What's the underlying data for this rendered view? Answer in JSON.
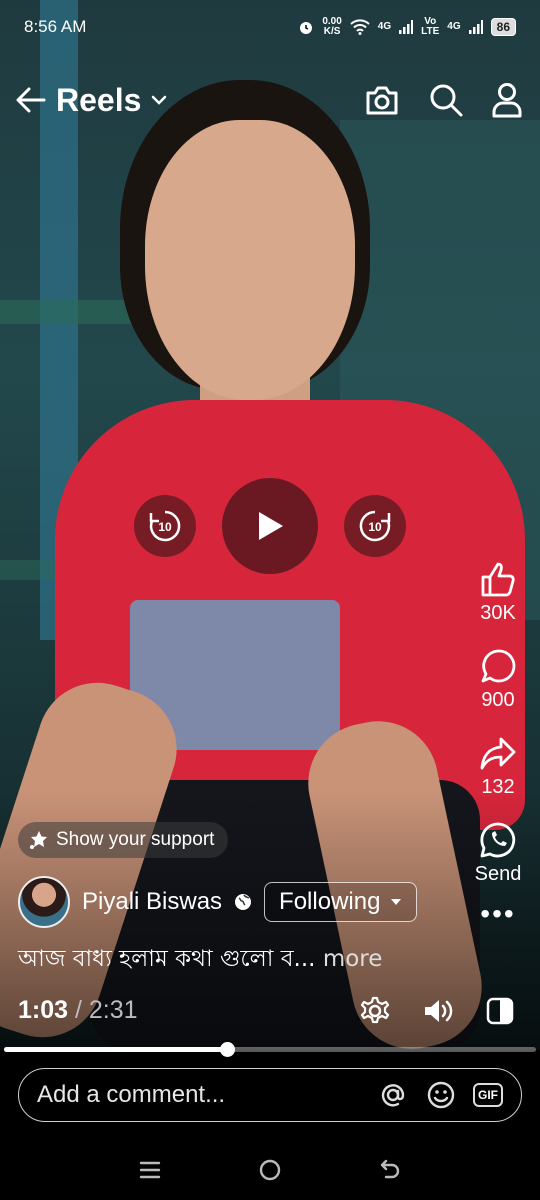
{
  "status_bar": {
    "time": "8:56 AM",
    "speed_value": "0.00",
    "speed_unit": "K/S",
    "network1": "4G",
    "network2_top": "Vo",
    "network2_bottom": "LTE",
    "network3": "4G",
    "battery": "86"
  },
  "header": {
    "title": "Reels",
    "icons": [
      "back-arrow-icon",
      "chevron-down-icon",
      "camera-icon",
      "search-icon",
      "profile-icon"
    ]
  },
  "playback": {
    "rewind_label": "10",
    "forward_label": "10",
    "state": "paused"
  },
  "actions": {
    "like_count": "30K",
    "comment_count": "900",
    "share_count": "132",
    "send_label": "Send",
    "more_label": "•••"
  },
  "support": {
    "label": "Show your support"
  },
  "author": {
    "name": "Piyali Biswas",
    "follow_label": "Following"
  },
  "caption": {
    "text": "আজ বাধ্য হলাম কথা গুলো ব...",
    "more_label": "more"
  },
  "progress": {
    "current": "1:03",
    "separator": "/",
    "duration": "2:31",
    "fraction": 0.42
  },
  "comment": {
    "placeholder": "Add a comment...",
    "gif_label": "GIF"
  },
  "colors": {
    "accent_overlay": "#3c1419",
    "shirt": "#d7263b"
  }
}
